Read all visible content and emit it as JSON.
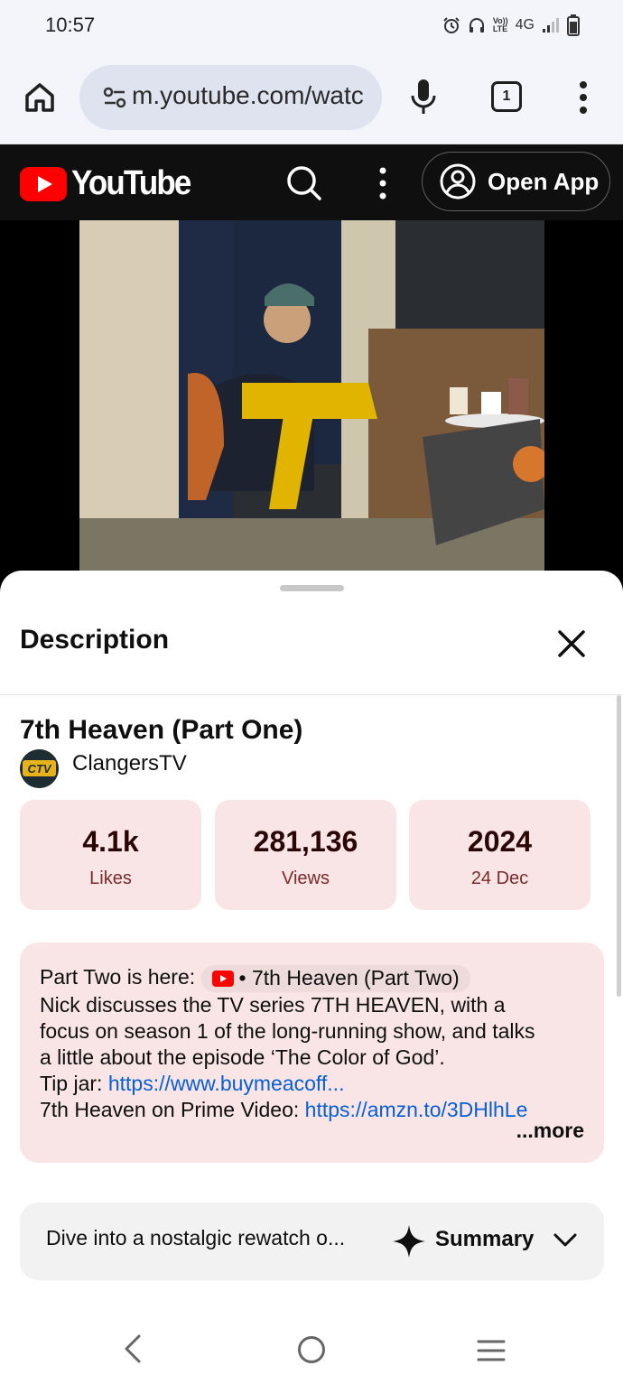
{
  "status_bar": {
    "time": "10:57",
    "network": "4G",
    "volte_top": "Vo))",
    "volte_bottom": "LTE"
  },
  "browser": {
    "url": "m.youtube.com/watc",
    "tab_count": "1"
  },
  "youtube_header": {
    "logo_text": "YouTube",
    "open_app_label": "Open App",
    "brand_color": "#ff0000"
  },
  "sheet": {
    "title": "Description",
    "video_title": "7th Heaven (Part One)",
    "channel_name": "ClangersTV",
    "channel_avatar_text": "CTV",
    "stats": [
      {
        "value": "4.1k",
        "label": "Likes"
      },
      {
        "value": "281,136",
        "label": "Views"
      },
      {
        "value": "2024",
        "label": "24 Dec"
      }
    ],
    "description": {
      "part_two_prefix": "Part Two is here:",
      "part_two_chip": "• 7th Heaven (Part Two)",
      "line2": "Nick discusses the TV series 7TH HEAVEN, with a",
      "line3": "focus on season 1 of the long-running show, and talks",
      "line4": "a little about the episode ‘The Color of God’.",
      "tip_prefix": "Tip jar: ",
      "tip_link": "https://www.buymeacoff...",
      "prime_prefix": "7th Heaven on Prime Video: ",
      "prime_link": "https://amzn.to/3DHlhLe",
      "more_label": "...more"
    },
    "summary": {
      "preview": "Dive into a nostalgic rewatch o...",
      "label": "Summary"
    }
  }
}
